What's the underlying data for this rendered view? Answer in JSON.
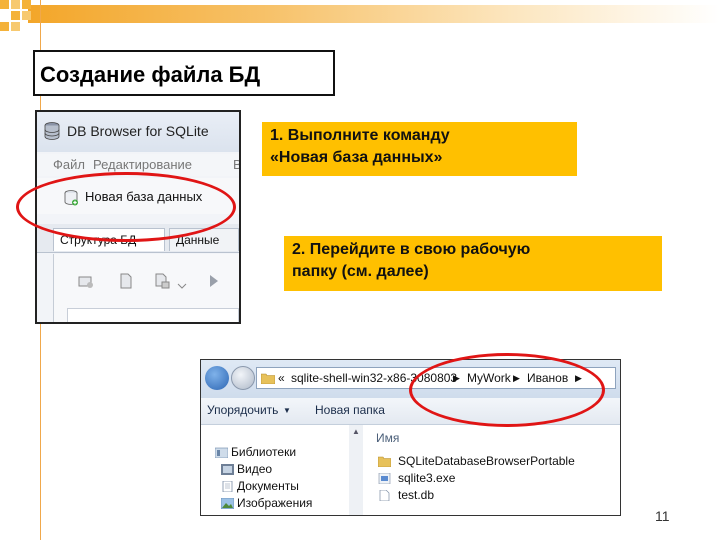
{
  "slide": {
    "title": "Создание файла БД",
    "page_number": "11",
    "accent_color": "#ffc000"
  },
  "callouts": {
    "step1": [
      "1. Выполните команду",
      "«Новая база данных»"
    ],
    "step2": [
      "2. Перейдите в свою рабочую",
      "папку (см. далее)"
    ]
  },
  "db_browser": {
    "window_title": "DB Browser for SQLite",
    "menu": [
      "Файл",
      "Редактирование",
      "В"
    ],
    "toolbar_new_db": "Новая база данных",
    "tabs": [
      "Структура БД",
      "Данные"
    ]
  },
  "explorer": {
    "breadcrumbs": [
      "sqlite-shell-win32-x86-3080803",
      "MyWork",
      "Иванов"
    ],
    "commands": [
      "Упорядочить",
      "Новая папка"
    ],
    "nav": [
      "Библиотеки",
      "Видео",
      "Документы",
      "Изображения"
    ],
    "column_header": "Имя",
    "files": [
      "SQLiteDatabaseBrowserPortable",
      "sqlite3.exe",
      "test.db"
    ]
  }
}
